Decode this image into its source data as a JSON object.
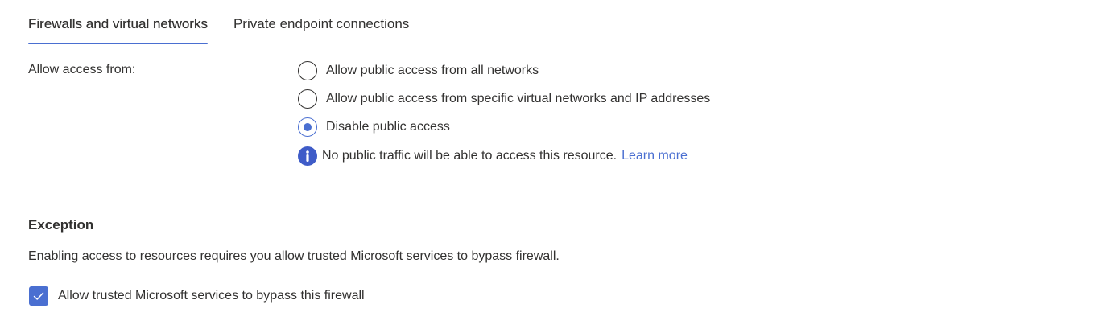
{
  "tabs": [
    {
      "label": "Firewalls and virtual networks",
      "active": true
    },
    {
      "label": "Private endpoint connections",
      "active": false
    }
  ],
  "access": {
    "label": "Allow access from:",
    "options": [
      {
        "label": "Allow public access from all networks",
        "checked": false
      },
      {
        "label": "Allow public access from specific virtual networks and IP addresses",
        "checked": false
      },
      {
        "label": "Disable public access",
        "checked": true
      }
    ],
    "info": {
      "icon": "info-icon",
      "text": "No public traffic will be able to access this resource.",
      "link": "Learn more"
    }
  },
  "exception": {
    "title": "Exception",
    "description": "Enabling access to resources requires you allow trusted Microsoft services to bypass firewall.",
    "checkbox": {
      "label": "Allow trusted Microsoft services to bypass this firewall",
      "checked": true
    }
  },
  "colors": {
    "accent": "#4a6fd1",
    "info": "#3f5cc8",
    "text": "#323130"
  }
}
